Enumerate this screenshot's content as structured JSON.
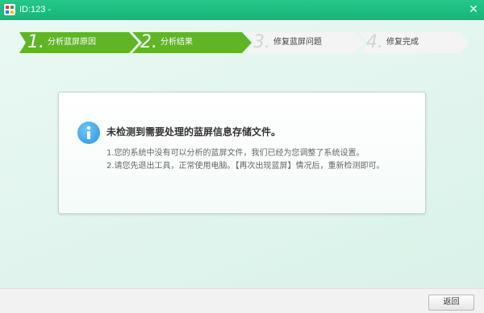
{
  "window": {
    "title": "ID:123 -",
    "close_glyph": "✕",
    "icon": "app-logo-icon"
  },
  "steps": [
    {
      "num": "1.",
      "label": "分析蓝屏原因",
      "active": true
    },
    {
      "num": "2.",
      "label": "分析结果",
      "active": true
    },
    {
      "num": "3.",
      "label": "修复蓝屏问题",
      "active": false
    },
    {
      "num": "4.",
      "label": "修复完成",
      "active": false
    }
  ],
  "message": {
    "icon": "info-icon",
    "title": "未检测到需要处理的蓝屏信息存储文件。",
    "line1": "1.您的系统中没有可以分析的蓝屏文件，我们已经为您调整了系统设置。",
    "line2": "2.请您先退出工具，正常使用电脑。【再次出现蓝屏】情况后，重新检测即可。"
  },
  "footer": {
    "back_label": "返回"
  },
  "colors": {
    "titlebar": "#1fbe82",
    "step_active": "#5fb526",
    "step_inactive": "#f2f3f2",
    "info_blue": "#2b95dd"
  }
}
